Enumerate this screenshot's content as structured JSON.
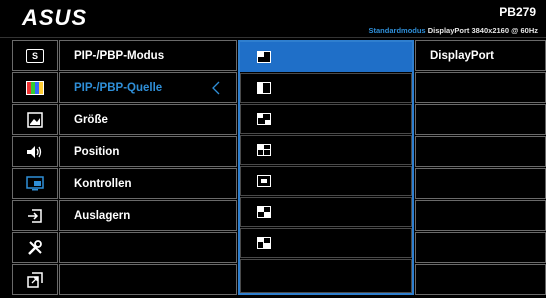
{
  "header": {
    "brand": "ASUS",
    "model": "PB279",
    "mode": "Standardmodus",
    "input_info": "DisplayPort  3840x2160 @ 60Hz"
  },
  "colors": {
    "accent": "#2f8fd8",
    "selected_bg": "#1f6fc8",
    "border": "#6a6a6a"
  },
  "sidebar": {
    "items": [
      {
        "icon": "splendid-icon"
      },
      {
        "icon": "color-icon"
      },
      {
        "icon": "image-icon"
      },
      {
        "icon": "sound-icon"
      },
      {
        "icon": "pip-icon"
      },
      {
        "icon": "input-select-icon"
      },
      {
        "icon": "system-setup-icon"
      },
      {
        "icon": "shortcut-icon"
      }
    ]
  },
  "main_menu": {
    "items": [
      {
        "label": "PIP-/PBP-Modus"
      },
      {
        "label": "PIP-/PBP-Quelle"
      },
      {
        "label": "Größe"
      },
      {
        "label": "Position"
      },
      {
        "label": "Kontrollen"
      },
      {
        "label": "Auslagern"
      },
      {
        "label": ""
      },
      {
        "label": ""
      }
    ],
    "active_index": 1
  },
  "pip_options": {
    "items": [
      {
        "icon": "pip-top-left-icon"
      },
      {
        "icon": "pip-left-half-icon"
      },
      {
        "icon": "pip-split-three-icon"
      },
      {
        "icon": "pip-quad-icon"
      },
      {
        "icon": "pip-center-icon"
      },
      {
        "icon": "pip-grid-icon"
      },
      {
        "icon": "pip-four-panel-icon"
      },
      {
        "icon": ""
      }
    ],
    "selected_index": 0
  },
  "source_menu": {
    "items": [
      {
        "label": "DisplayPort"
      },
      {
        "label": ""
      },
      {
        "label": ""
      },
      {
        "label": ""
      },
      {
        "label": ""
      },
      {
        "label": ""
      },
      {
        "label": ""
      },
      {
        "label": ""
      }
    ]
  }
}
